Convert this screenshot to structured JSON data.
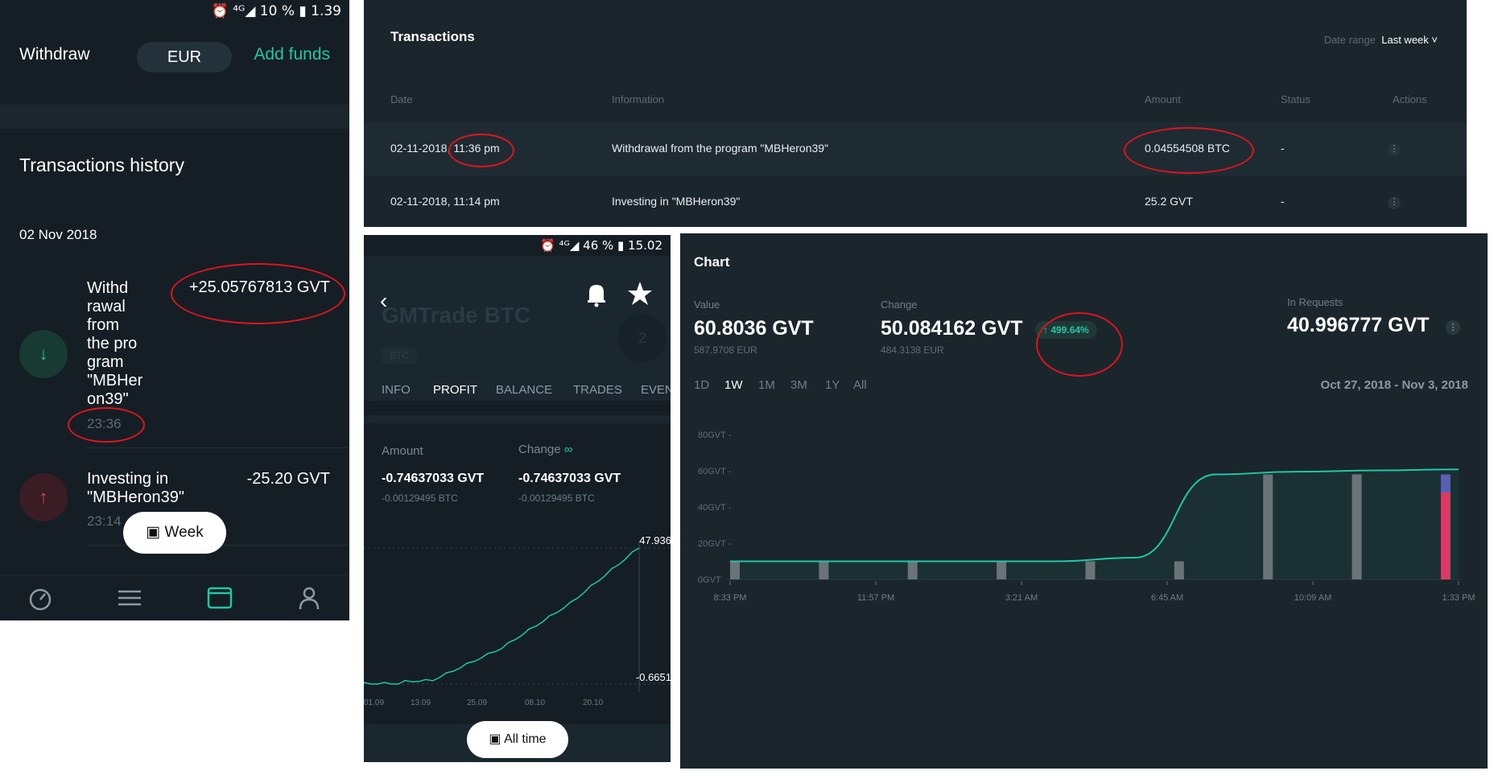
{
  "mobile_history": {
    "status_bar": "⏰ ⁴ᴳ◢ 10 % ▮ 1.39",
    "withdraw_label": "Withdraw",
    "currency": "EUR",
    "add_funds_label": "Add funds",
    "section_title": "Transactions history",
    "date_header": "02 Nov 2018",
    "items": [
      {
        "text_lines": [
          "Withd",
          "rawal",
          "from",
          "the pro",
          "gram",
          "\"MBHer",
          "on39\""
        ],
        "amount": "+25.05767813 GVT",
        "time": "23:36",
        "icon": "arrow-down-icon"
      },
      {
        "text_lines": [
          "Investing in",
          "\"MBHeron39\""
        ],
        "amount": "-25.20 GVT",
        "time": "23:14",
        "icon": "arrow-up-icon"
      }
    ],
    "week_button": "Week",
    "nav": [
      "dashboard-icon",
      "menu-icon",
      "wallet-icon",
      "profile-icon"
    ]
  },
  "desktop_transactions": {
    "title": "Transactions",
    "date_range_label": "Date range",
    "date_range_value": "Last week ˅",
    "columns": [
      "Date",
      "Information",
      "Amount",
      "Status",
      "Actions"
    ],
    "rows": [
      {
        "date": "02-11-2018, 11:36 pm",
        "info": "Withdrawal from the program \"MBHeron39\"",
        "amount": "0.04554508 BTC",
        "status": "-"
      },
      {
        "date": "02-11-2018, 11:14 pm",
        "info": "Investing in \"MBHeron39\"",
        "amount": "25.2 GVT",
        "status": "-"
      }
    ],
    "actions_glyph": "⋮"
  },
  "mobile_profit": {
    "status_bar": "⏰ ⁴ᴳ◢ 46 % ▮ 15.02",
    "program_name": "GMTrade BTC",
    "currency_tag": "BTC",
    "level_badge": "2",
    "tabs": [
      "INFO",
      "PROFIT",
      "BALANCE",
      "TRADES",
      "EVENTS"
    ],
    "active_tab": "PROFIT",
    "amount_label": "Amount",
    "change_label": "Change",
    "change_symbol": "∞",
    "amount_value": "-0.74637033 GVT",
    "amount_sub": "-0.00129495 BTC",
    "change_value": "-0.74637033 GVT",
    "change_sub": "-0.00129495 BTC",
    "chart_high_label": "47.936",
    "chart_low_label": "-0.6651",
    "x_ticks": [
      "01.09",
      "13.09",
      "25.09",
      "08.10",
      "20.10"
    ],
    "all_time_button": "All time"
  },
  "desktop_chart": {
    "title": "Chart",
    "value_label": "Value",
    "value": "60.8036 GVT",
    "value_sub": "587.9708 EUR",
    "change_label": "Change",
    "change": "50.084162 GVT",
    "change_sub": "484.3138 EUR",
    "change_pct": "↑ 499.64%",
    "requests_label": "In Requests",
    "requests": "40.996777 GVT",
    "ranges": [
      "1D",
      "1W",
      "1M",
      "3M",
      "1Y",
      "All"
    ],
    "active_range": "1W",
    "date_span": "Oct 27, 2018 - Nov 3, 2018",
    "accent_color": "#1fc7a7"
  },
  "chart_data": [
    {
      "type": "line",
      "title": "",
      "x": [
        "01.09",
        "13.09",
        "25.09",
        "08.10",
        "20.10"
      ],
      "series": [
        {
          "name": "",
          "values": [
            -0.6651,
            0.5,
            12,
            28,
            47.936
          ]
        }
      ],
      "y_labels": [
        "47.936",
        "-0.6651"
      ]
    },
    {
      "type": "area",
      "title": "Chart",
      "x": [
        "8:33 PM",
        "11:57 PM",
        "3:21 AM",
        "6:45 AM",
        "10:09 AM",
        "1:33 PM"
      ],
      "y_ticks": [
        "0GVT",
        "20GVT",
        "40GVT",
        "60GVT",
        "80GVT"
      ],
      "ylim": [
        0,
        80
      ],
      "series": [
        {
          "name": "",
          "values": [
            10,
            10,
            10,
            10,
            10,
            12,
            58,
            59.5,
            60.2,
            60.8
          ]
        }
      ],
      "bars": [
        {
          "x": 0.0,
          "value": 10
        },
        {
          "x": 1.0,
          "value": 10
        },
        {
          "x": 2.0,
          "value": 10
        },
        {
          "x": 3.0,
          "value": 10
        },
        {
          "x": 4.0,
          "value": 10
        },
        {
          "x": 5.0,
          "value": 10
        },
        {
          "x": 6.0,
          "value": 58
        },
        {
          "x": 7.0,
          "value": 58
        },
        {
          "x": 8.0,
          "value": 58,
          "split": [
            48,
            10
          ]
        }
      ],
      "colors": {
        "line": "#1fc7a7",
        "bar": "#6a7378",
        "bar_top": "#5b5fb4",
        "bar_bottom": "#d83b64"
      }
    }
  ]
}
